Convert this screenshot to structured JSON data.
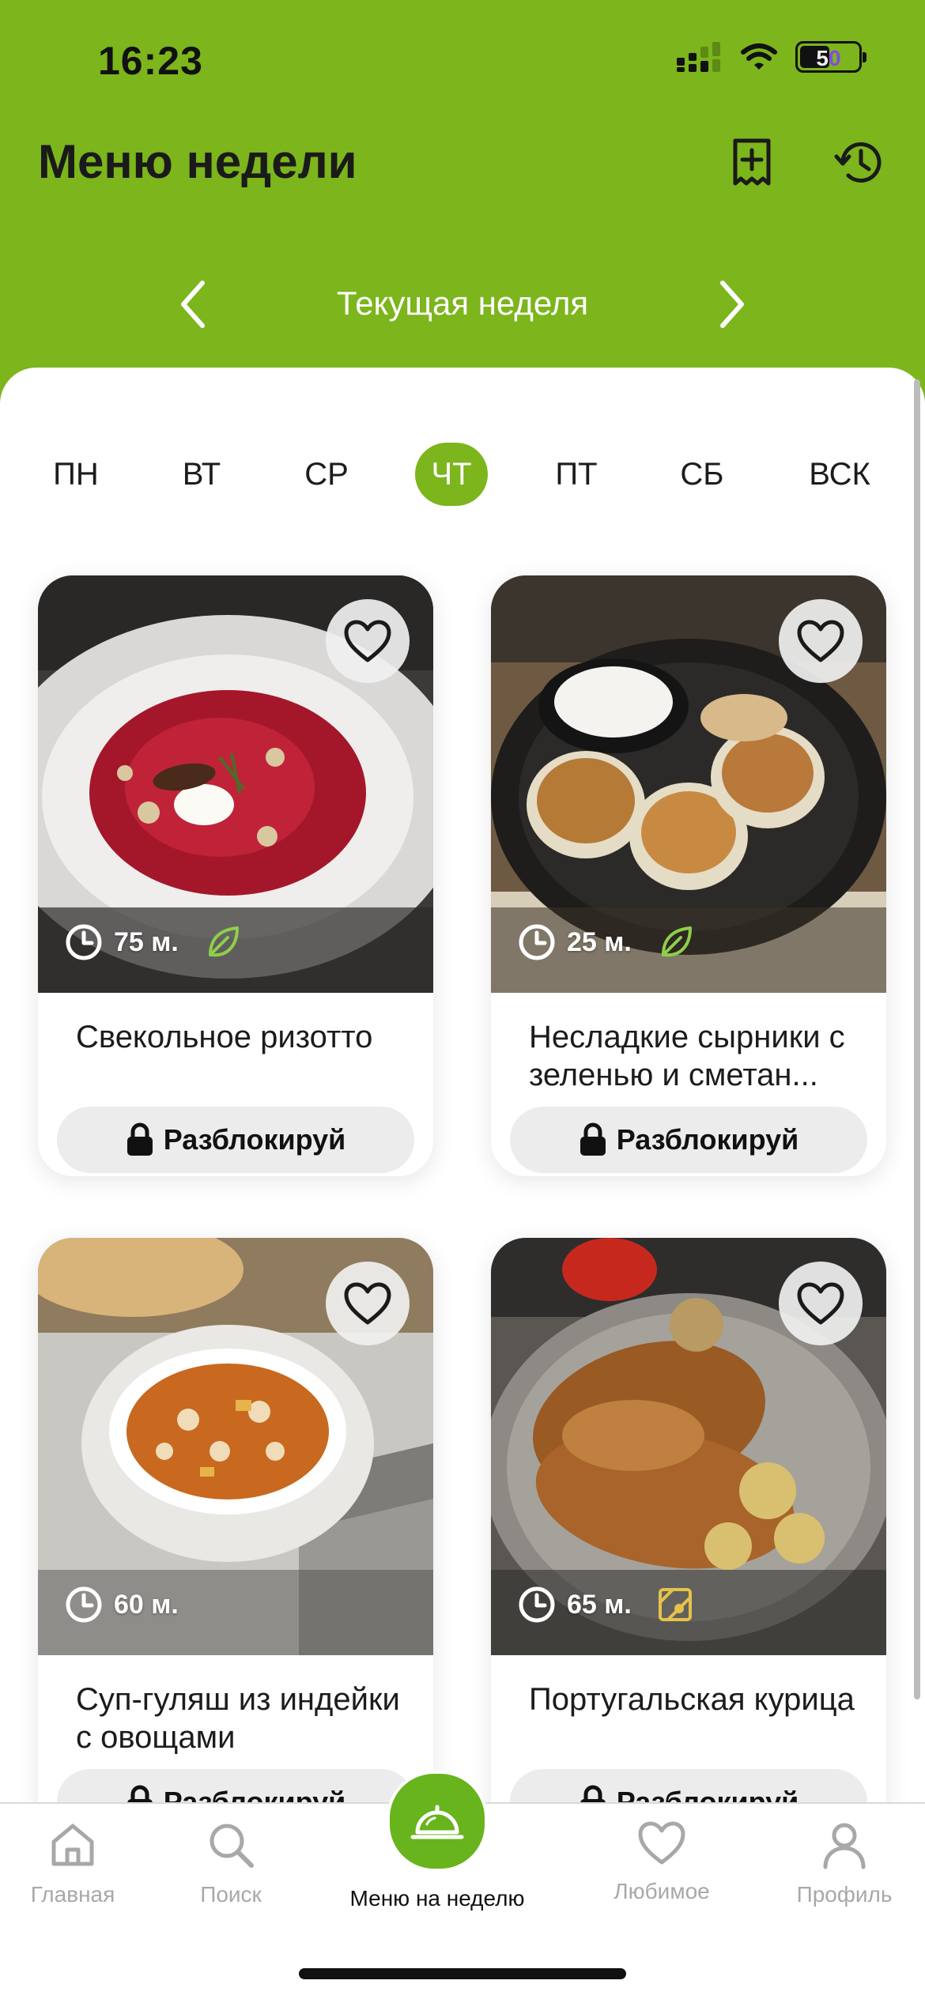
{
  "status_bar": {
    "time": "16:23",
    "battery": "50"
  },
  "header": {
    "title": "Меню недели",
    "week_label": "Текущая неделя"
  },
  "days": {
    "items": [
      "ПН",
      "ВТ",
      "СР",
      "ЧТ",
      "ПТ",
      "СБ",
      "ВСК"
    ],
    "active": "ЧТ"
  },
  "recipes": [
    {
      "name": "Свекольное ризотто",
      "time": "75 м.",
      "badge_icon": "leaf-icon",
      "action": "Разблокируй"
    },
    {
      "name": "Несладкие сырники с зеленью и сметан...",
      "time": "25 м.",
      "badge_icon": "leaf-icon",
      "action": "Разблокируй"
    },
    {
      "name": "Суп-гуляш из индейки с овощами",
      "time": "60 м.",
      "badge_icon": "",
      "action": "Разблокируй"
    },
    {
      "name": "Португальская курица",
      "time": "65 м.",
      "badge_icon": "spice-icon",
      "action": "Разблокируй"
    }
  ],
  "tab_bar": {
    "items": [
      {
        "label": "Главная",
        "icon": "home-icon"
      },
      {
        "label": "Поиск",
        "icon": "search-icon"
      },
      {
        "label": "Меню на неделю",
        "icon": "cloche-icon"
      },
      {
        "label": "Любимое",
        "icon": "heart-icon"
      },
      {
        "label": "Профиль",
        "icon": "profile-icon"
      }
    ]
  },
  "colors": {
    "accent": "#7cb51c",
    "tab_inactive": "#a8a8a8",
    "leaf_badge": "#8fcf4a",
    "spice_badge": "#e6c24a"
  }
}
